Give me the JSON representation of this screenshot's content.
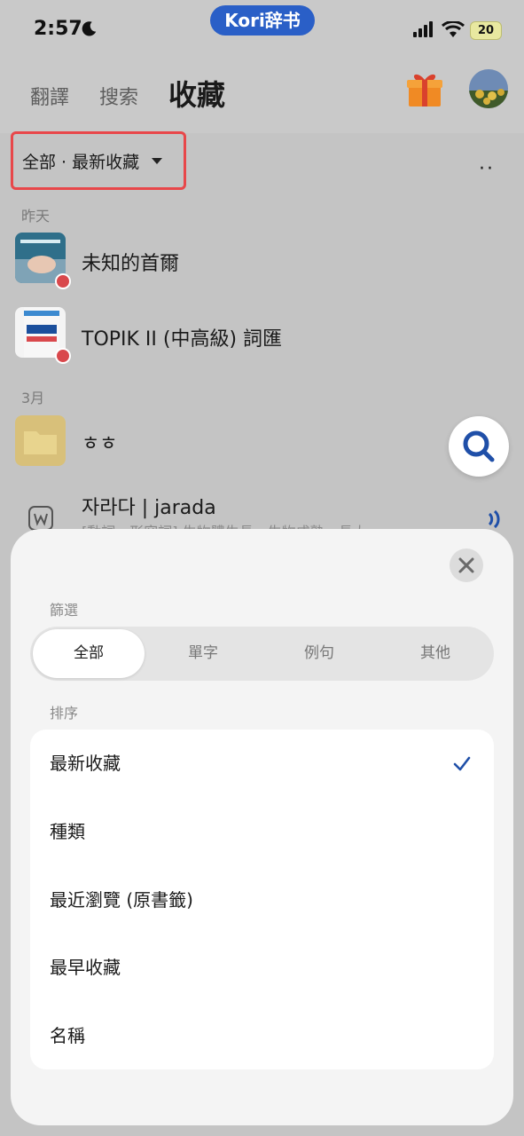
{
  "status_bar": {
    "time": "2:57",
    "app_name": "Kori辞书",
    "battery": "20"
  },
  "header": {
    "tabs": [
      "翻譯",
      "搜索",
      "收藏"
    ]
  },
  "filter_bar": {
    "label": "全部 · 最新收藏",
    "more": "··"
  },
  "list": {
    "sections": [
      {
        "label": "昨天",
        "items": [
          {
            "title": "未知的首爾"
          },
          {
            "title": "TOPIK II (中高級) 詞匯"
          }
        ]
      },
      {
        "label": "3月",
        "items": [
          {
            "title": "ㅎㅎ"
          },
          {
            "title": "자라다 | jarada",
            "subtitle": "[動詞，形容詞] 生物體生長、生物成熟、長大"
          }
        ]
      }
    ]
  },
  "sheet": {
    "filter_heading": "篩選",
    "filter_options": [
      "全部",
      "單字",
      "例句",
      "其他"
    ],
    "sort_heading": "排序",
    "sort_options": [
      "最新收藏",
      "種類",
      "最近瀏覽 (原書籤)",
      "最早收藏",
      "名稱"
    ],
    "selected_sort": "最新收藏"
  },
  "colors": {
    "accent": "#2a5fc7",
    "badge": "#d9484c",
    "highlight_border": "#e8474a"
  },
  "icons": [
    "moon-icon",
    "signal-icon",
    "wifi-icon",
    "gift-icon",
    "search-icon",
    "close-icon",
    "check-icon",
    "chevron-down-icon",
    "folder-icon",
    "word-icon",
    "audio-icon"
  ]
}
